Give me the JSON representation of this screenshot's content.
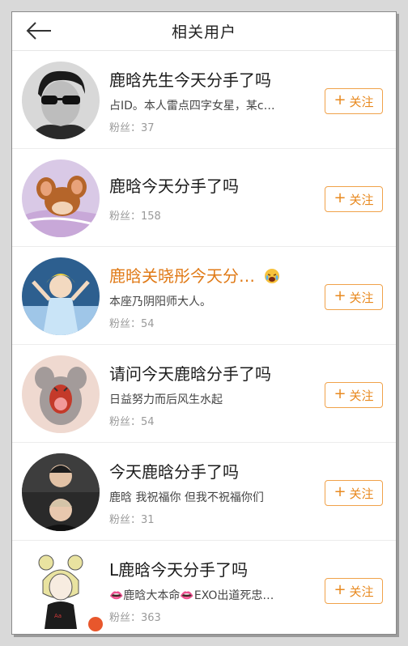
{
  "header": {
    "title": "相关用户"
  },
  "follow_label": "关注",
  "users": [
    {
      "name": "鹿晗先生今天分手了吗",
      "bio": "占ID。本人雷点四字女星，某c…",
      "fans_label": "粉丝：37"
    },
    {
      "name": "鹿晗今天分手了吗",
      "bio": "",
      "fans_label": "粉丝：158"
    },
    {
      "name": "鹿晗关晓彤今天分…",
      "bio": "本座乃阴阳师大人。",
      "fans_label": "粉丝：54"
    },
    {
      "name": "请问今天鹿晗分手了吗",
      "bio": "日益努力而后风生水起",
      "fans_label": "粉丝：54"
    },
    {
      "name": "今天鹿晗分手了吗",
      "bio": "鹿晗 我祝福你 但我不祝福你们",
      "fans_label": "粉丝：31"
    },
    {
      "name": "L鹿晗今天分手了吗",
      "bio": "👄鹿晗大本命👄EXO出道死忠…",
      "fans_label": "粉丝：363"
    }
  ],
  "colors": {
    "accent": "#e8891f",
    "name_highlight": "#e07a17"
  }
}
